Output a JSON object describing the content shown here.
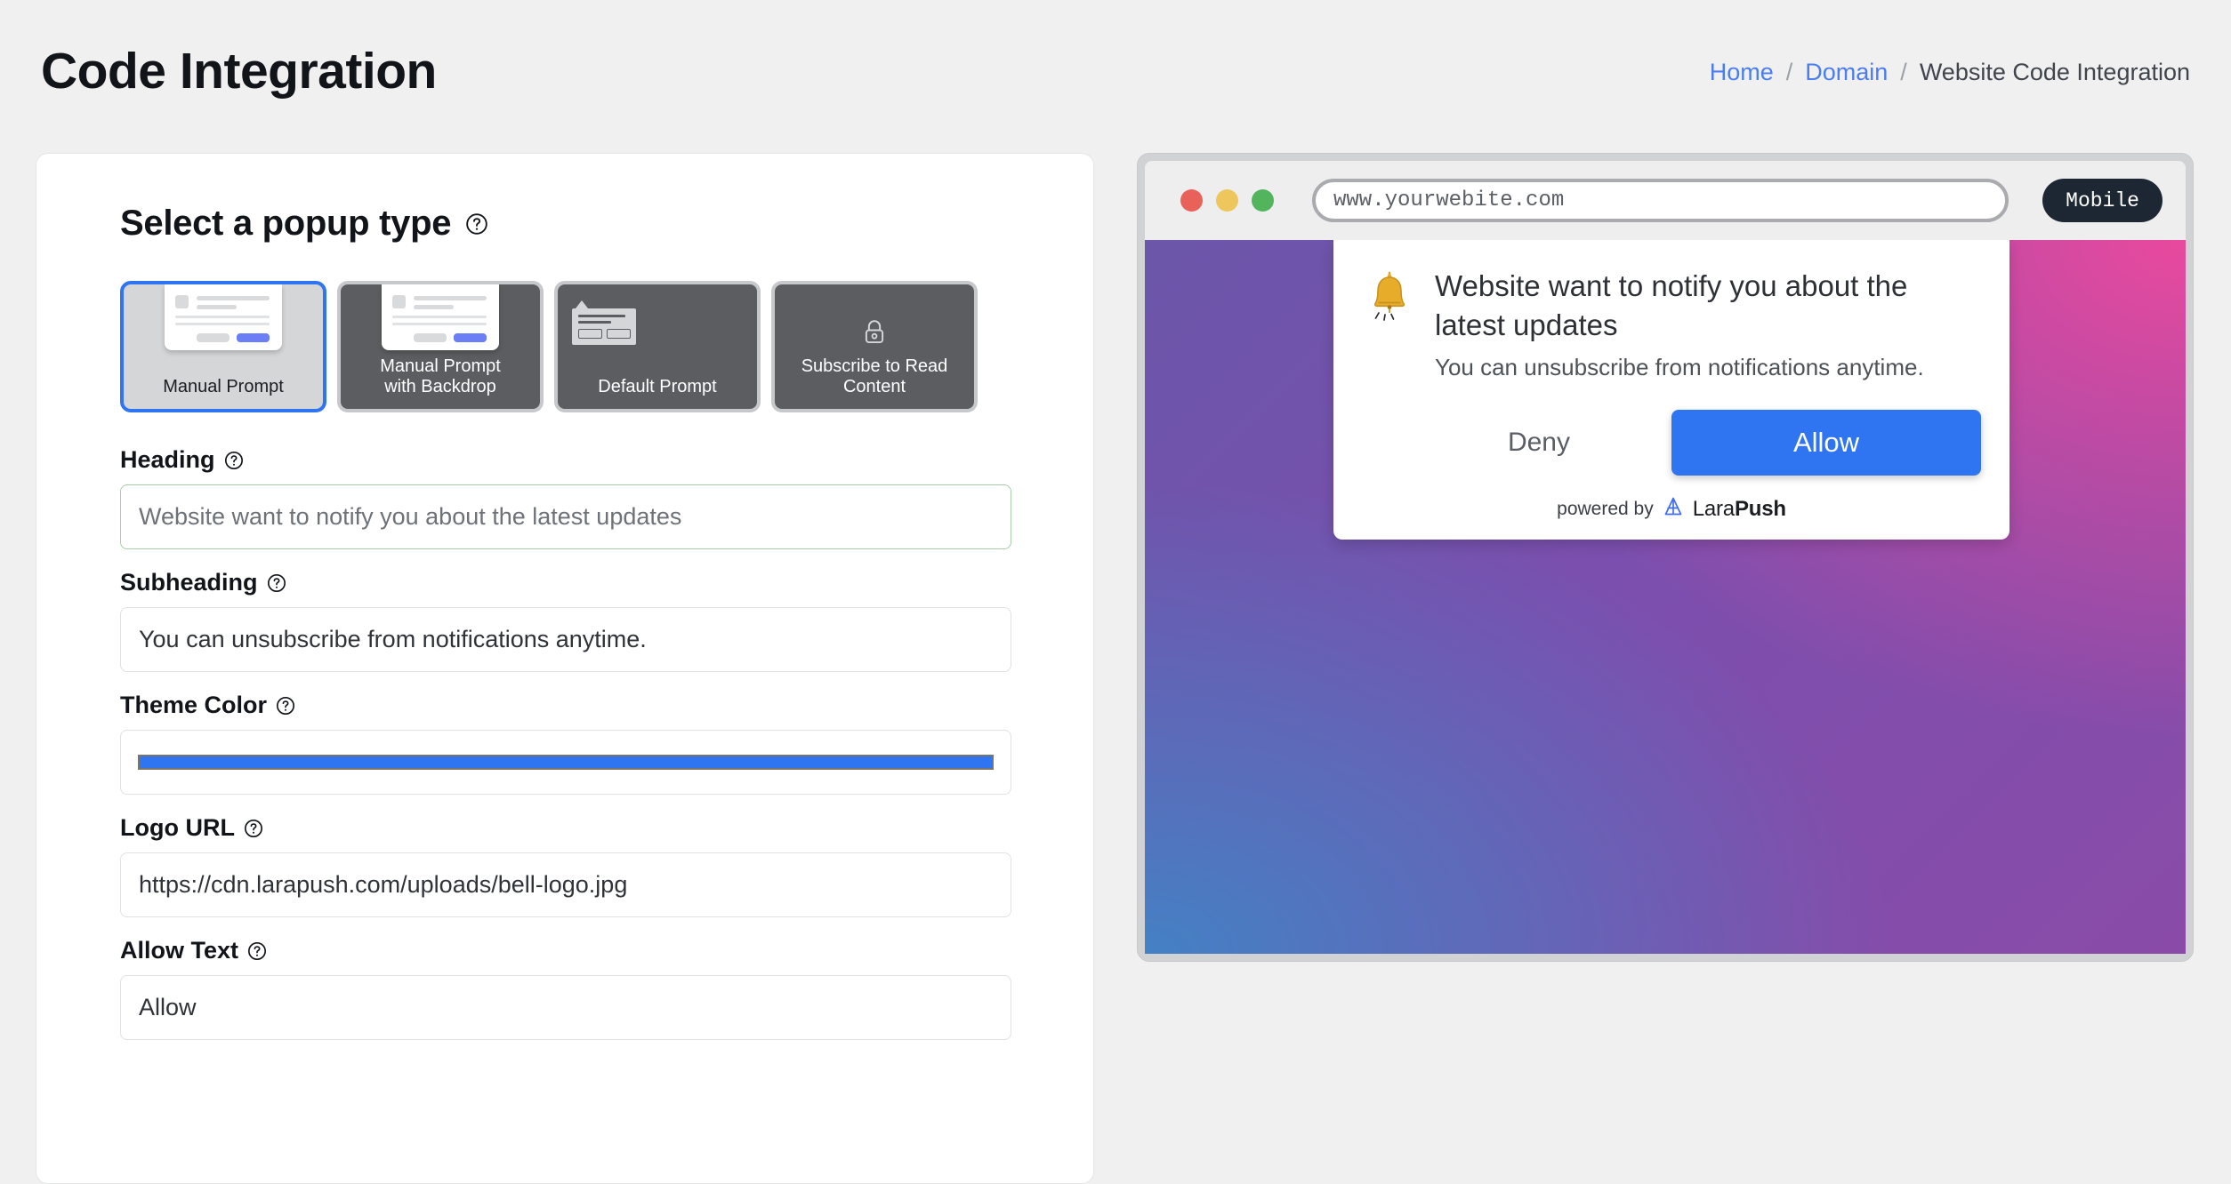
{
  "header": {
    "title": "Code Integration",
    "breadcrumb": {
      "home": "Home",
      "sep1": "/",
      "domain": "Domain",
      "sep2": "/",
      "current": "Website Code Integration"
    }
  },
  "form": {
    "section_title": "Select a popup type",
    "popup_types": [
      {
        "label": "Manual Prompt",
        "selected": true
      },
      {
        "label": "Manual Prompt\nwith Backdrop",
        "line1": "Manual Prompt",
        "line2": "with Backdrop",
        "selected": false
      },
      {
        "label": "Default Prompt",
        "selected": false
      },
      {
        "label": "Subscribe to Read\nContent",
        "line1": "Subscribe to Read",
        "line2": "Content",
        "selected": false
      }
    ],
    "fields": {
      "heading": {
        "label": "Heading",
        "value": "Website want to notify you about the latest updates",
        "placeholder": "Website want to notify you about the latest updates"
      },
      "subheading": {
        "label": "Subheading",
        "value": "You can unsubscribe from notifications anytime.",
        "placeholder": "You can unsubscribe from notifications anytime."
      },
      "theme_color": {
        "label": "Theme Color",
        "value": "#2f74f0"
      },
      "logo_url": {
        "label": "Logo URL",
        "value": "https://cdn.larapush.com/uploads/bell-logo.jpg",
        "placeholder": "https://cdn.larapush.com/uploads/bell-logo.jpg"
      },
      "allow_text": {
        "label": "Allow Text",
        "value": "Allow",
        "placeholder": "Allow"
      }
    }
  },
  "preview": {
    "browser": {
      "url": "www.yourwebite.com",
      "device_toggle": "Mobile"
    },
    "notification": {
      "heading": "Website want to notify you about the latest updates",
      "subheading": "You can unsubscribe from notifications anytime.",
      "deny_label": "Deny",
      "allow_label": "Allow",
      "powered_by": "powered by",
      "brand_prefix": "Lara",
      "brand_suffix": "Push"
    }
  },
  "colors": {
    "accent_blue": "#2f74f0",
    "link_blue": "#4c7df0",
    "gradient_top_left": "#6b56aa",
    "gradient_top_right": "#e8499e",
    "gradient_bottom_left": "#4481c4",
    "gradient_bottom_right": "#8a4ba8",
    "card_dark": "#5b5d60",
    "card_selected_bg": "#d4d6d8",
    "valid_border_green": "#a8ceab"
  }
}
